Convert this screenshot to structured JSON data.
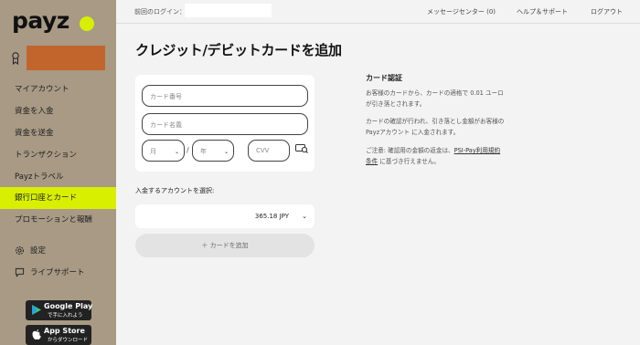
{
  "brand": {
    "logo_text": "payz",
    "accent_color": "#d8f000"
  },
  "sidebar": {
    "user_icon": "user-badge-icon",
    "items": [
      {
        "label": "マイアカウント",
        "active": false
      },
      {
        "label": "資金を入金",
        "active": false
      },
      {
        "label": "資金を送金",
        "active": false
      },
      {
        "label": "トランザクション",
        "active": false
      },
      {
        "label": "Payzトラベル",
        "active": false
      },
      {
        "label": "銀行口座とカード",
        "active": true
      },
      {
        "label": "プロモーションと報酬",
        "active": false
      }
    ],
    "settings_label": "設定",
    "support_label": "ライブサポート",
    "google_play": {
      "main": "Google Play",
      "sub": "で手に入れよう"
    },
    "app_store": {
      "main": "App Store",
      "sub": "からダウンロード"
    }
  },
  "topbar": {
    "last_login_label": "前回のログイン：",
    "message_center": "メッセージセンター (0)",
    "help": "ヘルプ＆サポート",
    "logout": "ログアウト"
  },
  "main": {
    "title": "クレジット/デビットカードを追加",
    "card_number_placeholder": "カード番号",
    "card_name_placeholder": "カード名義",
    "month_placeholder": "月",
    "year_placeholder": "年",
    "slash": "/",
    "cvv_placeholder": "CVV",
    "account_label": "入金するアカウントを選択:",
    "account_value": "365.18  JPY",
    "add_card_label": "＋  カードを追加"
  },
  "info": {
    "title": "カード認証",
    "p1": "お客様のカードから、カードの適格で 0.01 ユーロが引き落とされます。",
    "p2": "カードの確認が行われ、引き落とし金額がお客様の Payzアカウント に入金されます。",
    "p3_prefix": "ご注意: 確認用の金額の返金は、",
    "p3_link": "PSI-Pay利用規約条件",
    "p3_suffix": " に基づき行えません。"
  }
}
